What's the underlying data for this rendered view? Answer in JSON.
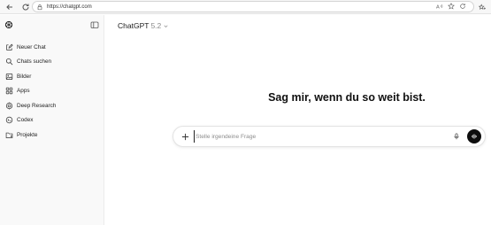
{
  "browser": {
    "url": "https://chatgpt.com",
    "icons": [
      "back-icon",
      "reload-icon",
      "lock-icon",
      "read-aloud-icon",
      "favorite-star-icon",
      "refresh-icon"
    ]
  },
  "sidebar": {
    "logo_icon": "openai-logo-icon",
    "toggle_icon": "sidebar-toggle-icon",
    "items": [
      {
        "label": "Neuer Chat",
        "icon": "compose-icon"
      },
      {
        "label": "Chats suchen",
        "icon": "search-icon"
      },
      {
        "label": "Bilder",
        "icon": "image-icon"
      },
      {
        "label": "Apps",
        "icon": "apps-grid-icon"
      },
      {
        "label": "Deep Research",
        "icon": "research-icon"
      },
      {
        "label": "Codex",
        "icon": "codex-icon"
      },
      {
        "label": "Projekte",
        "icon": "folder-icon"
      }
    ]
  },
  "header": {
    "model_name": "ChatGPT",
    "model_version": "5.2"
  },
  "main": {
    "headline": "Sag mir, wenn du so weit bist.",
    "composer": {
      "placeholder": "Stelle irgendeine Frage"
    }
  },
  "colors": {
    "sidebar_bg": "#f9f9f9",
    "accent_button": "#0d0d0d"
  }
}
